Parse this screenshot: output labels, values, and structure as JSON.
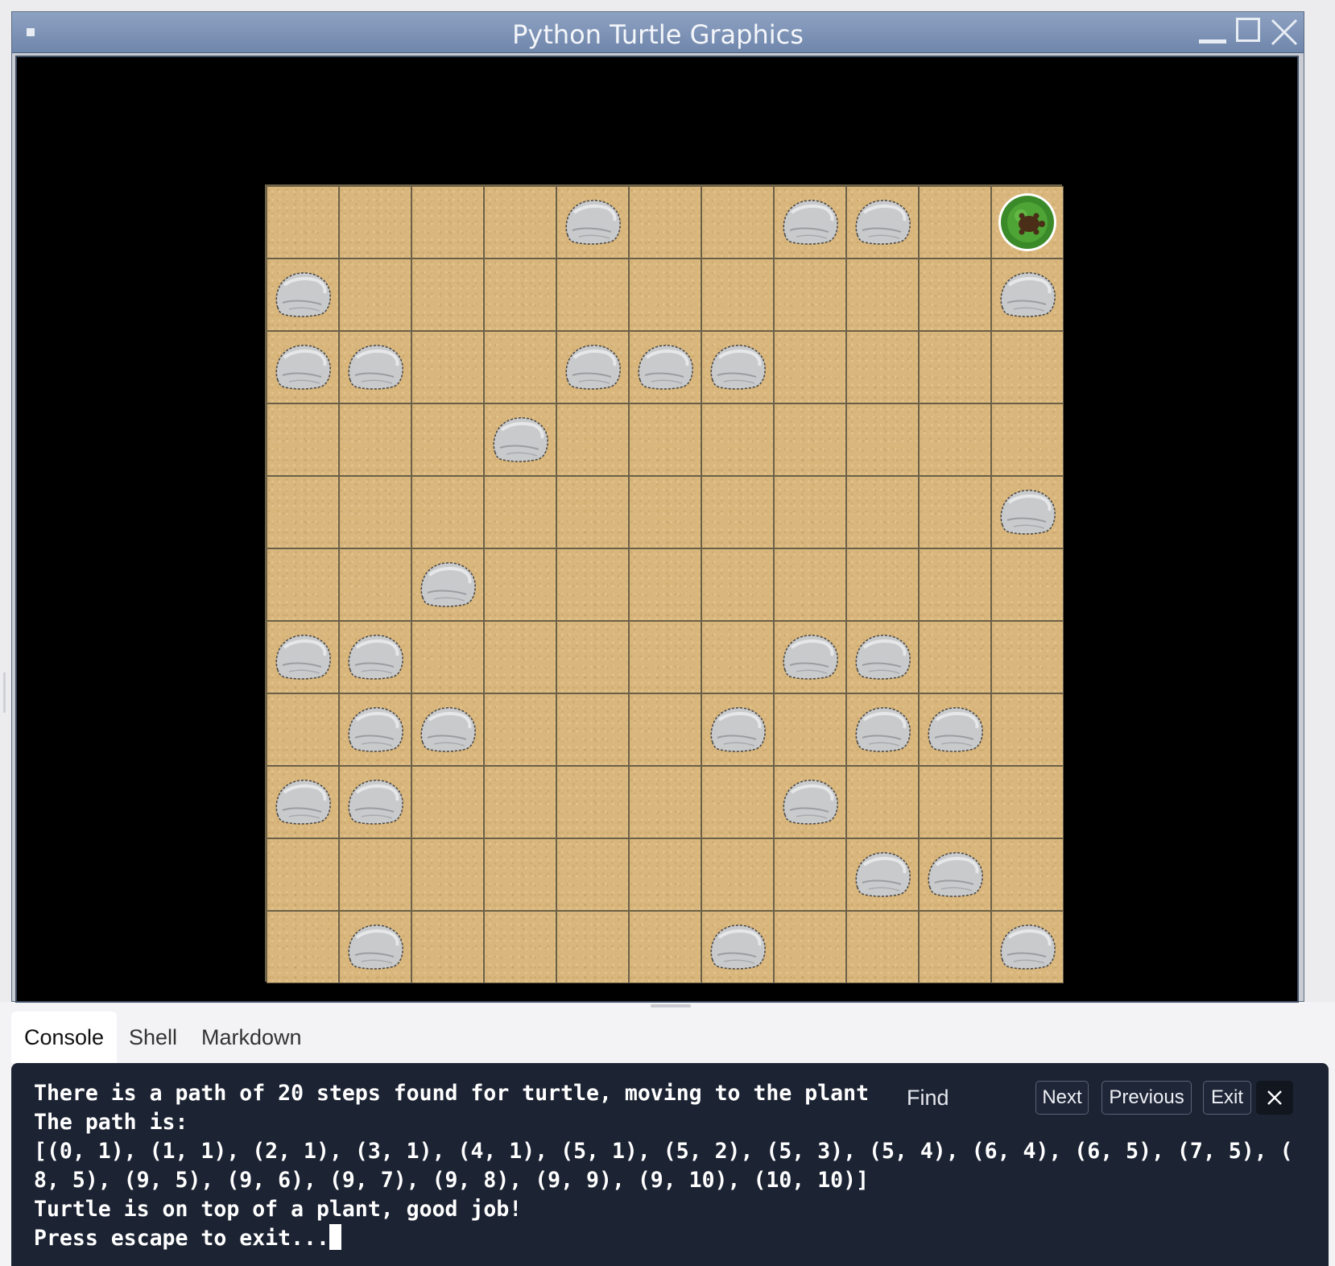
{
  "window": {
    "title": "Python Turtle Graphics"
  },
  "game": {
    "rows": 11,
    "cols": 11,
    "rocks": [
      [
        0,
        4
      ],
      [
        0,
        7
      ],
      [
        0,
        8
      ],
      [
        1,
        0
      ],
      [
        1,
        10
      ],
      [
        2,
        0
      ],
      [
        2,
        1
      ],
      [
        2,
        4
      ],
      [
        2,
        5
      ],
      [
        2,
        6
      ],
      [
        3,
        3
      ],
      [
        4,
        10
      ],
      [
        5,
        2
      ],
      [
        6,
        0
      ],
      [
        6,
        1
      ],
      [
        6,
        7
      ],
      [
        6,
        8
      ],
      [
        7,
        1
      ],
      [
        7,
        2
      ],
      [
        7,
        6
      ],
      [
        7,
        8
      ],
      [
        7,
        9
      ],
      [
        8,
        0
      ],
      [
        8,
        1
      ],
      [
        8,
        7
      ],
      [
        9,
        8
      ],
      [
        9,
        9
      ],
      [
        10,
        1
      ],
      [
        10,
        6
      ],
      [
        10,
        10
      ]
    ],
    "plant": [
      0,
      10
    ],
    "colors": {
      "sand": "#d9b67c",
      "grid_line": "#6b6047",
      "rock": "#c8c9cb",
      "plant": "#3b8a2a",
      "background": "#000000"
    }
  },
  "tabs": [
    {
      "label": "Console",
      "active": true
    },
    {
      "label": "Shell",
      "active": false
    },
    {
      "label": "Markdown",
      "active": false
    }
  ],
  "console": {
    "lines": [
      "There is a path of 20 steps found for turtle, moving to the plant",
      "The path is:",
      "[(0, 1), (1, 1), (2, 1), (3, 1), (4, 1), (5, 1), (5, 2), (5, 3), (5, 4), (6, 4), (6, 5), (7, 5), (",
      "8, 5), (9, 5), (9, 6), (9, 7), (9, 8), (9, 9), (9, 10), (10, 10)]",
      "Turtle is on top of a plant, good job!",
      "Press escape to exit..."
    ]
  },
  "find": {
    "label": "Find",
    "next": "Next",
    "previous": "Previous",
    "exit": "Exit"
  }
}
